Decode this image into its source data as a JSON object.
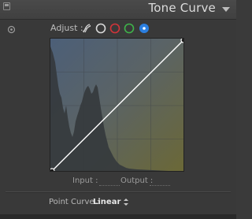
{
  "header": {
    "title": "Tone Curve"
  },
  "adjust": {
    "label": "Adjust :",
    "channels": [
      {
        "name": "rgb",
        "color": "#d9d9d9",
        "selected": false
      },
      {
        "name": "red",
        "color": "#d2343a",
        "selected": false
      },
      {
        "name": "green",
        "color": "#3fb34a",
        "selected": false
      },
      {
        "name": "blue",
        "color": "#2b7fe0",
        "selected": true
      }
    ]
  },
  "graph": {
    "curve": "linear",
    "line_color": "#ffffff",
    "histogram_color": "#3b3e40"
  },
  "io": {
    "input_label": "Input :",
    "output_label": "Output :"
  },
  "point_curve": {
    "label": "Point Curve :",
    "value": "Linear"
  }
}
